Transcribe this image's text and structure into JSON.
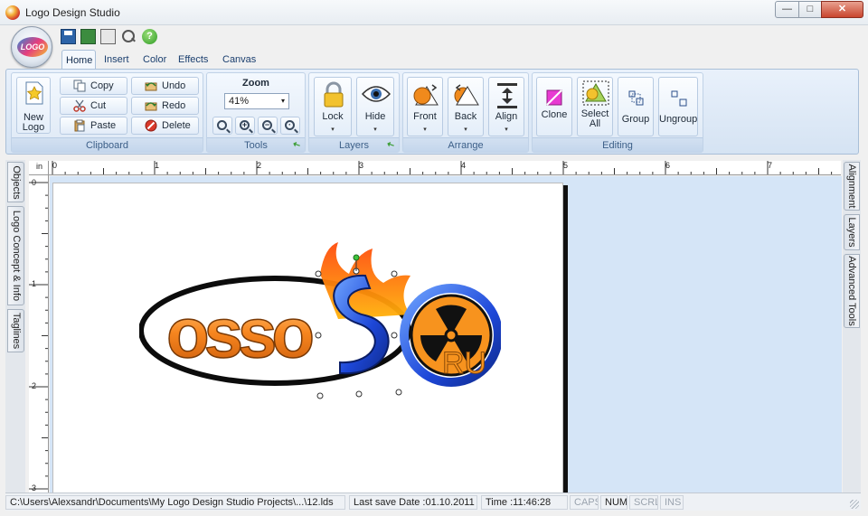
{
  "window": {
    "title": "Logo Design Studio",
    "minimize_glyph": "—",
    "maximize_glyph": "□",
    "close_glyph": "✕"
  },
  "app_orb": {
    "label": "LOGO"
  },
  "quick_access": {
    "help_glyph": "?"
  },
  "tabs": [
    {
      "label": "Home",
      "active": true
    },
    {
      "label": "Insert"
    },
    {
      "label": "Color"
    },
    {
      "label": "Effects"
    },
    {
      "label": "Canvas"
    }
  ],
  "ribbon": {
    "clipboard": {
      "label": "Clipboard",
      "new_logo": [
        "New",
        "Logo"
      ],
      "copy": "Copy",
      "cut": "Cut",
      "paste": "Paste",
      "undo": "Undo",
      "redo": "Redo",
      "delete": "Delete"
    },
    "tools": {
      "label": "Tools",
      "zoom_title": "Zoom",
      "zoom_value": "41%",
      "zoom_glyphs": [
        "",
        "+",
        "−",
        "·"
      ]
    },
    "layers": {
      "label": "Layers",
      "lock": "Lock",
      "hide": "Hide"
    },
    "arrange": {
      "label": "Arrange",
      "front": "Front",
      "back": "Back",
      "align": "Align"
    },
    "editing": {
      "label": "Editing",
      "clone": "Clone",
      "select_all": [
        "Select",
        "All"
      ],
      "group": "Group",
      "ungroup": "Ungroup"
    },
    "dropdown_caret": "▾"
  },
  "rulers": {
    "unit": "in",
    "h_labels": [
      "0",
      "1",
      "2",
      "3",
      "4",
      "5",
      "6",
      "7"
    ],
    "v_labels": [
      "0",
      "1",
      "2",
      "3"
    ]
  },
  "left_dock": [
    "Objects",
    "Logo Concept & Info",
    "Taglines"
  ],
  "right_dock": [
    "Alignment",
    "Layers",
    "Advanced Tools"
  ],
  "logo": {
    "main_text": "osso",
    "suffix": "RU"
  },
  "status": {
    "path": "C:\\Users\\Alexsandr\\Documents\\My Logo Design Studio Projects\\...\\12.lds",
    "last_save": "Last save Date :01.10.2011",
    "time": "Time :11:46:28",
    "caps": "CAPS",
    "num": "NUM",
    "scrl": "SCRL",
    "ins": "INS"
  }
}
